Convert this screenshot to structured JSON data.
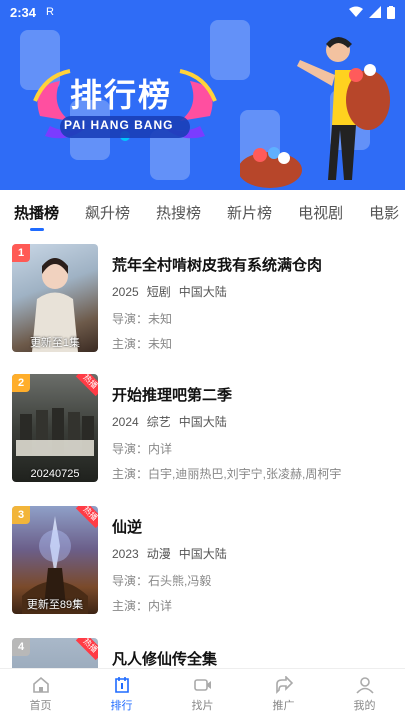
{
  "status_bar": {
    "time": "2:34",
    "indicator": "R"
  },
  "banner": {
    "title": "排行榜",
    "subtitle": "PAI HANG BANG"
  },
  "tabs": [
    {
      "label": "热播榜",
      "active": true
    },
    {
      "label": "飙升榜",
      "active": false
    },
    {
      "label": "热搜榜",
      "active": false
    },
    {
      "label": "新片榜",
      "active": false
    },
    {
      "label": "电视剧",
      "active": false
    },
    {
      "label": "电影",
      "active": false
    }
  ],
  "items": [
    {
      "rank": "1",
      "rank_color": "#ff5a55",
      "title": "荒年全村啃树皮我有系统满仓肉",
      "year": "2025",
      "genre": "短剧",
      "region": "中国大陆",
      "director": "导演：未知",
      "cast": "主演：未知",
      "poster_badge": "更新至1集",
      "hot": false
    },
    {
      "rank": "2",
      "rank_color": "#ffae2b",
      "title": "开始推理吧第二季",
      "year": "2024",
      "genre": "综艺",
      "region": "中国大陆",
      "director": "导演：内详",
      "cast": "主演：白宇,迪丽热巴,刘宇宁,张凌赫,周柯宇",
      "poster_badge": "20240725",
      "hot": true
    },
    {
      "rank": "3",
      "rank_color": "#f2b53a",
      "title": "仙逆",
      "year": "2023",
      "genre": "动漫",
      "region": "中国大陆",
      "director": "导演：石头熊,冯毅",
      "cast": "主演：内详",
      "poster_badge": "更新至89集",
      "hot": true
    },
    {
      "rank": "4",
      "rank_color": "#b8b8b8",
      "title": "凡人修仙传全集",
      "year": "",
      "genre": "",
      "region": "",
      "director": "",
      "cast": "",
      "poster_badge": "",
      "hot": true
    }
  ],
  "hot_label": "热播",
  "nav": [
    {
      "label": "首页",
      "icon": "home-icon",
      "active": false
    },
    {
      "label": "排行",
      "icon": "rank-icon",
      "active": true
    },
    {
      "label": "找片",
      "icon": "video-icon",
      "active": false
    },
    {
      "label": "推广",
      "icon": "share-icon",
      "active": false
    },
    {
      "label": "我的",
      "icon": "user-icon",
      "active": false
    }
  ],
  "colors": {
    "accent": "#1f6bff",
    "banner": "#2f6cf6",
    "hot": "#ff3b45"
  }
}
